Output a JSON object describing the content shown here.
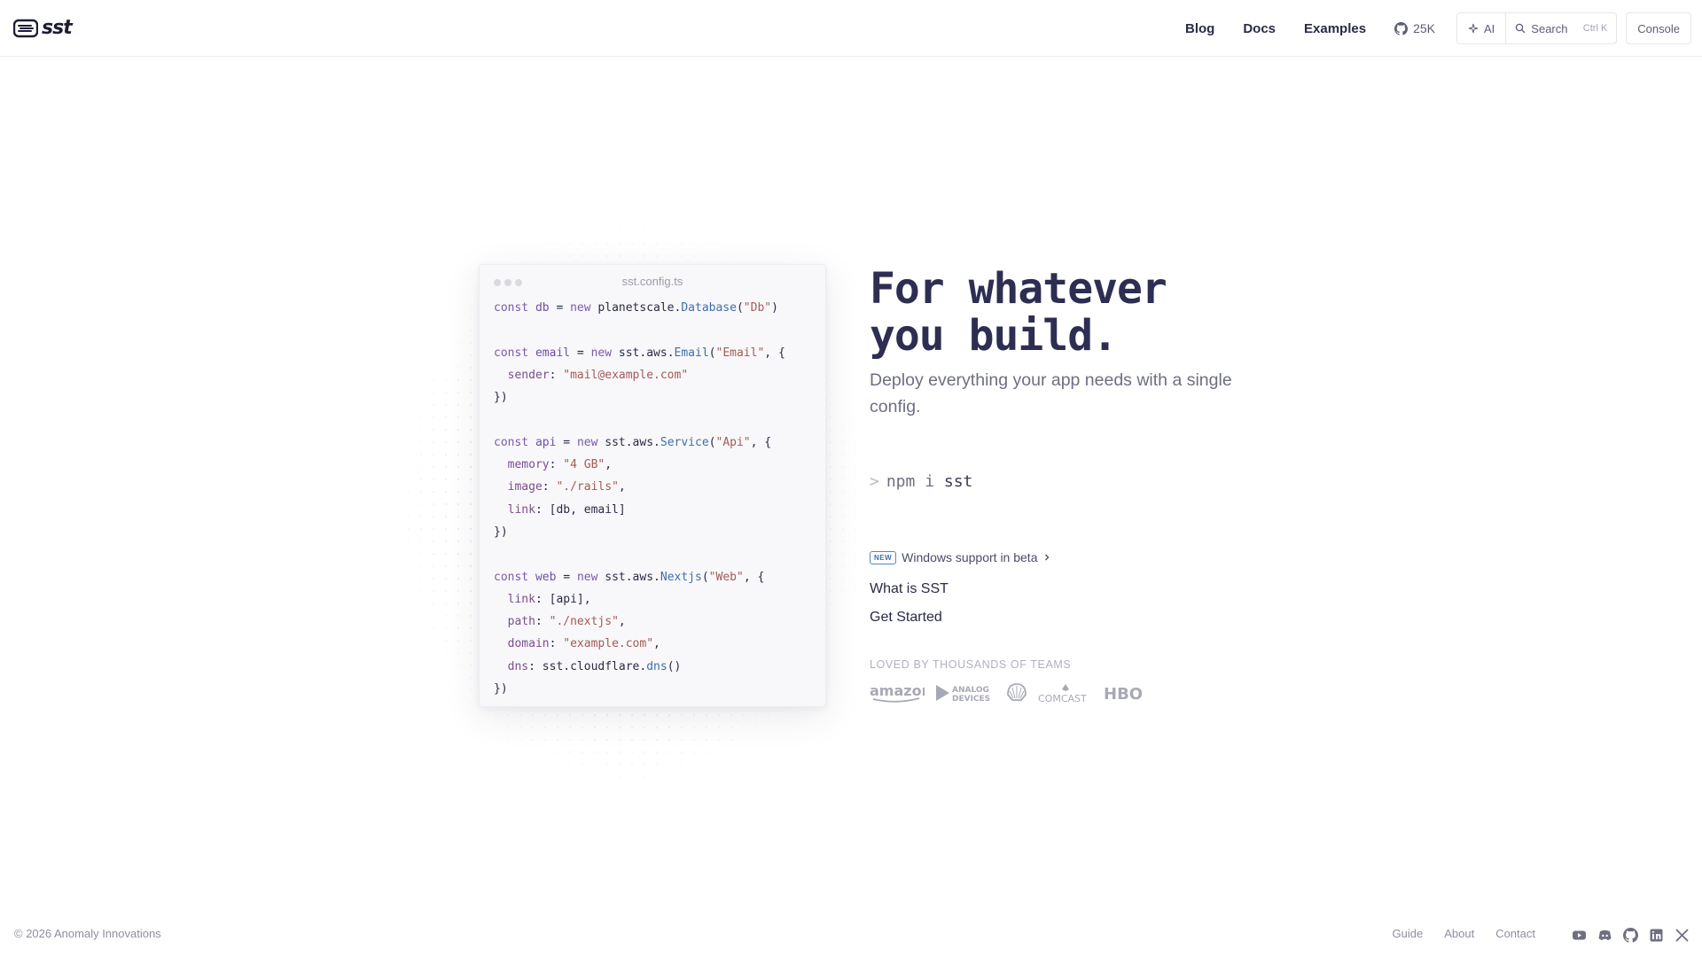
{
  "header": {
    "logo_text": "sst",
    "nav": [
      {
        "label": "Blog"
      },
      {
        "label": "Docs"
      },
      {
        "label": "Examples"
      }
    ],
    "github_stars": "25K",
    "ai_label": "AI",
    "search_label": "Search",
    "search_shortcut": "Ctrl K",
    "console_label": "Console"
  },
  "code_card": {
    "filename": "sst.config.ts"
  },
  "hero": {
    "title_line1": "For whatever",
    "title_line2": "you build.",
    "subtitle": "Deploy everything your app needs with a single config.",
    "install_prompt": ">",
    "install_cmd_a": "npm i",
    "install_cmd_b": "sst",
    "news_badge": "NEW",
    "news_text": "Windows support in beta",
    "link_what": "What is SST",
    "link_start": "Get Started",
    "loved_by": "LOVED BY THOUSANDS OF TEAMS",
    "customers": [
      "amazon",
      "ANALOG",
      "DEVICES",
      "COMCAST",
      "HBO"
    ]
  },
  "footer": {
    "copyright": "© 2026 Anomaly Innovations",
    "links": [
      {
        "label": "Guide"
      },
      {
        "label": "About"
      },
      {
        "label": "Contact"
      }
    ],
    "socials": [
      "youtube-icon",
      "discord-icon",
      "github-icon",
      "linkedin-icon",
      "x-icon"
    ]
  }
}
